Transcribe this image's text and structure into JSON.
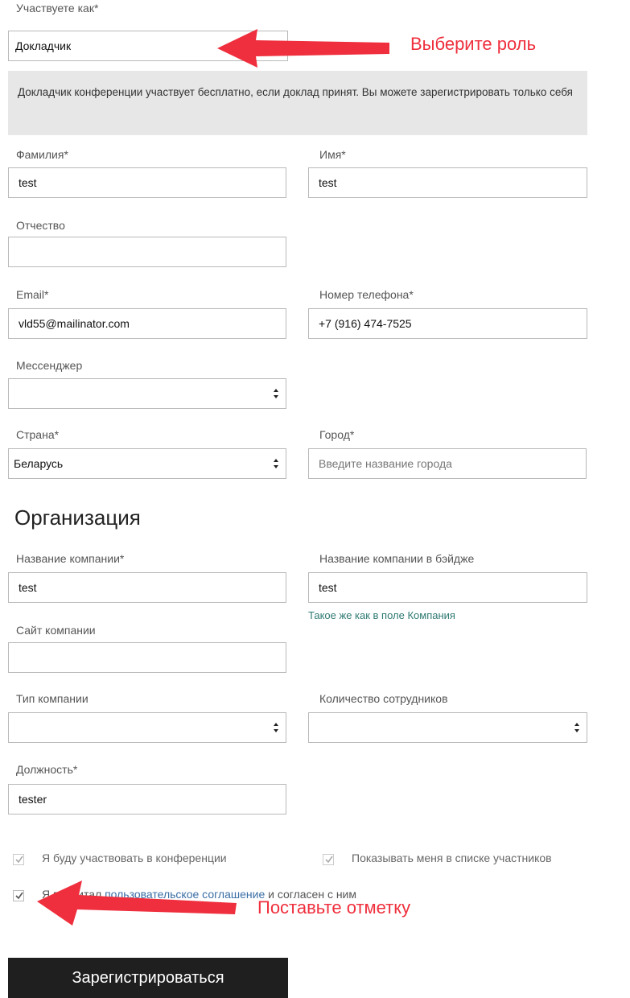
{
  "role": {
    "label": "Участвуете как*",
    "value": "Докладчик"
  },
  "info_text": "Докладчик конференции участвует бесплатно, если доклад принят. Вы можете зарегистрировать только себя",
  "fields": {
    "last_name": {
      "label": "Фамилия*",
      "value": "test"
    },
    "first_name": {
      "label": "Имя*",
      "value": "test"
    },
    "middle_name": {
      "label": "Отчество",
      "value": ""
    },
    "email": {
      "label": "Email*",
      "value": "vld55@mailinator.com"
    },
    "phone": {
      "label": "Номер телефона*",
      "value": "+7 (916) 474-7525"
    },
    "messenger": {
      "label": "Мессенджер",
      "value": ""
    },
    "country": {
      "label": "Страна*",
      "value": "Беларусь"
    },
    "city": {
      "label": "Город*",
      "value": "",
      "placeholder": "Введите название города"
    }
  },
  "organization": {
    "title": "Организация",
    "company_name": {
      "label": "Название компании*",
      "value": "test"
    },
    "badge_name": {
      "label": "Название компании в бэйдже",
      "value": "test",
      "hint": "Такое же как в поле Компания"
    },
    "website": {
      "label": "Сайт компании",
      "value": ""
    },
    "company_type": {
      "label": "Тип компании",
      "value": ""
    },
    "employees": {
      "label": "Количество сотрудников",
      "value": ""
    },
    "position": {
      "label": "Должность*",
      "value": "tester"
    }
  },
  "checkboxes": {
    "participate": {
      "label": "Я буду участвовать в конференции",
      "checked": true
    },
    "show_in_list": {
      "label": "Показывать меня в списке участников",
      "checked": true
    },
    "agreement": {
      "prefix": "Я прочитал",
      "link": "пользовательское соглашение",
      "suffix": "и согласен с ним",
      "checked": true
    }
  },
  "submit_label": "Зарегистрироваться",
  "annotations": {
    "role_hint": "Выберите роль",
    "check_hint": "Поставьте отметку"
  },
  "colors": {
    "annotation": "#ef2f3d",
    "button": "#1f1f1f",
    "link": "#3a6ea5",
    "hint": "#2f7a73",
    "info_bg": "#e7e7e7"
  }
}
